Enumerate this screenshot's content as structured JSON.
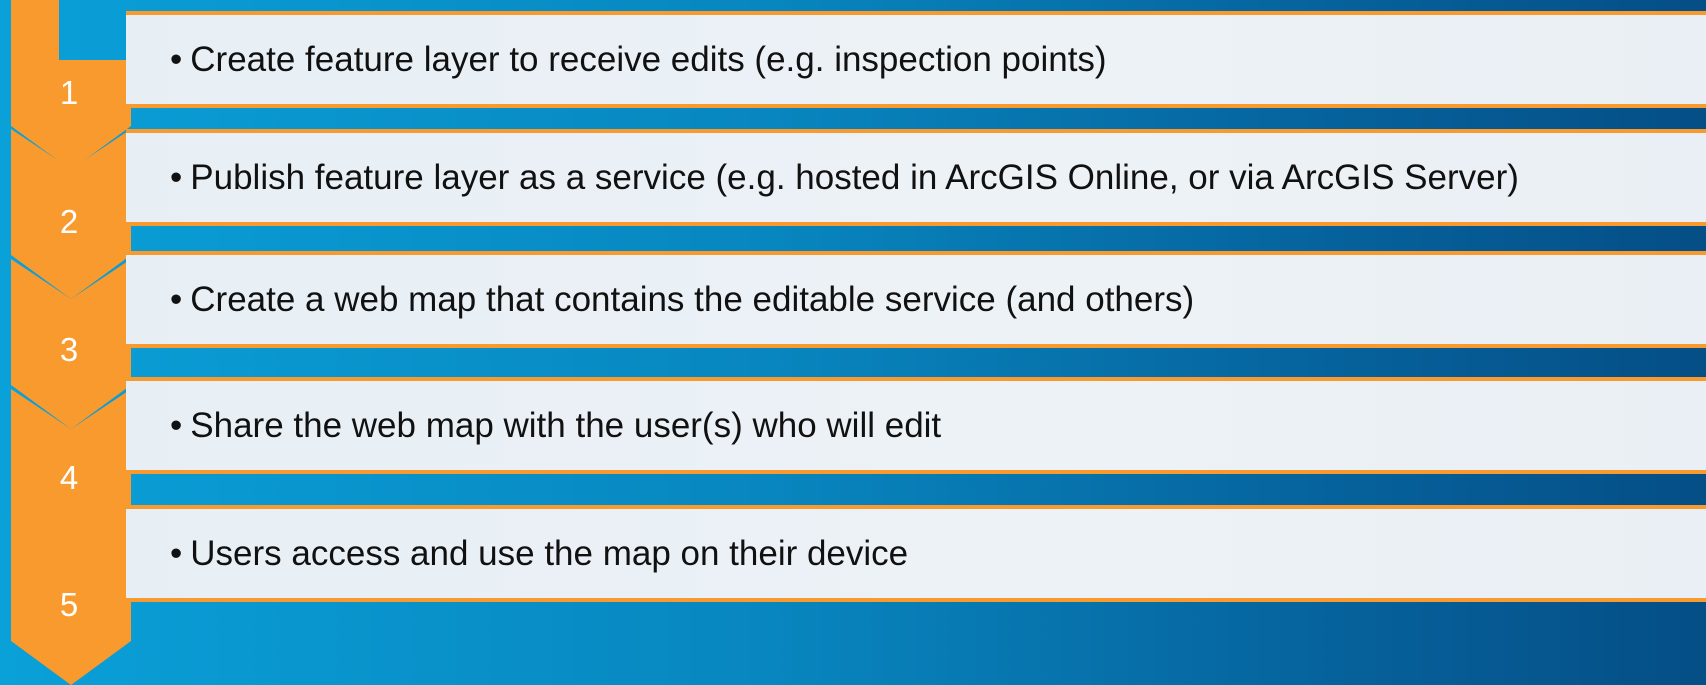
{
  "steps": [
    {
      "number": "1",
      "text": "Create feature layer to receive edits (e.g. inspection points)"
    },
    {
      "number": "2",
      "text": "Publish feature layer as a service (e.g. hosted in ArcGIS Online, or via ArcGIS Server)"
    },
    {
      "number": "3",
      "text": "Create a web map that contains the editable service (and others)"
    },
    {
      "number": "4",
      "text": "Share the web map with the user(s) who will edit"
    },
    {
      "number": "5",
      "text": "Users access and use the map on their device"
    }
  ],
  "bullet": "•",
  "colors": {
    "accent": "#f89a2d",
    "background_start": "#0aa0d8",
    "background_end": "#054e86",
    "box": "#e9f0f5",
    "number": "#ffffff",
    "text": "#111111"
  }
}
